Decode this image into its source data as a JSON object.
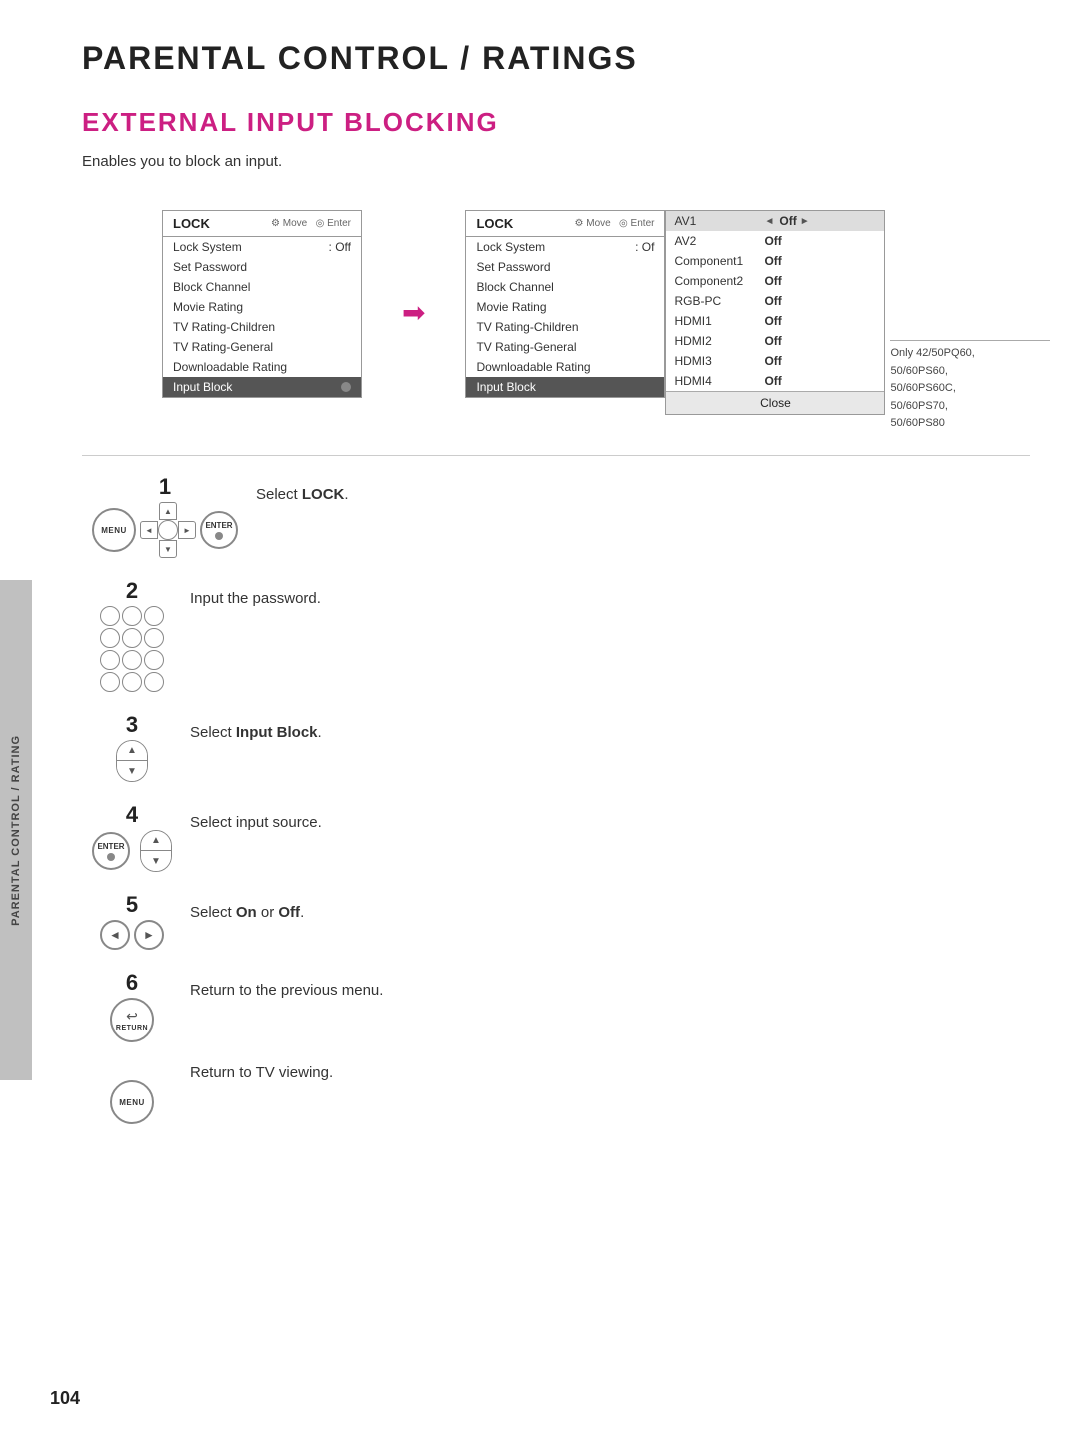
{
  "page": {
    "title": "PARENTAL CONTROL / RATINGS",
    "section_title": "EXTERNAL INPUT BLOCKING",
    "description": "Enables you to block an input.",
    "page_number": "104"
  },
  "sidebar": {
    "label": "PARENTAL CONTROL / RATING"
  },
  "left_menu": {
    "header_title": "LOCK",
    "header_nav": "Move   Enter",
    "items": [
      {
        "label": "Lock System",
        "value": ": Off",
        "highlighted": false
      },
      {
        "label": "Set Password",
        "value": "",
        "highlighted": false
      },
      {
        "label": "Block Channel",
        "value": "",
        "highlighted": false
      },
      {
        "label": "Movie Rating",
        "value": "",
        "highlighted": false
      },
      {
        "label": "TV Rating-Children",
        "value": "",
        "highlighted": false
      },
      {
        "label": "TV Rating-General",
        "value": "",
        "highlighted": false
      },
      {
        "label": "Downloadable Rating",
        "value": "",
        "highlighted": false
      },
      {
        "label": "Input Block",
        "value": "",
        "highlighted": true
      }
    ]
  },
  "right_menu": {
    "header_title": "LOCK",
    "header_nav": "Move   Enter",
    "items": [
      {
        "label": "Lock System",
        "value": ": Of",
        "highlighted": false
      },
      {
        "label": "Set Password",
        "value": "",
        "highlighted": false
      },
      {
        "label": "Block Channel",
        "value": "",
        "highlighted": false
      },
      {
        "label": "Movie Rating",
        "value": "",
        "highlighted": false
      },
      {
        "label": "TV Rating-Children",
        "value": "",
        "highlighted": false
      },
      {
        "label": "TV Rating-General",
        "value": "",
        "highlighted": false
      },
      {
        "label": "Downloadable Rating",
        "value": "",
        "highlighted": false
      },
      {
        "label": "Input Block",
        "value": "",
        "highlighted": true
      }
    ]
  },
  "submenu": {
    "inputs": [
      {
        "name": "AV1",
        "value": "Off",
        "has_arrows": true,
        "active": true
      },
      {
        "name": "AV2",
        "value": "Off",
        "has_arrows": false,
        "active": false
      },
      {
        "name": "Component1",
        "value": "Off",
        "has_arrows": false,
        "active": false
      },
      {
        "name": "Component2",
        "value": "Off",
        "has_arrows": false,
        "active": false
      },
      {
        "name": "RGB-PC",
        "value": "Off",
        "has_arrows": false,
        "active": false
      },
      {
        "name": "HDMI1",
        "value": "Off",
        "has_arrows": false,
        "active": false
      },
      {
        "name": "HDMI2",
        "value": "Off",
        "has_arrows": false,
        "active": false
      },
      {
        "name": "HDMI3",
        "value": "Off",
        "has_arrows": false,
        "active": false
      },
      {
        "name": "HDMI4",
        "value": "Off",
        "has_arrows": false,
        "active": false
      }
    ],
    "close_label": "Close",
    "side_note": "Only 42/50PQ60,\n50/60PS60,\n50/60PS60C,\n50/60PS70,\n50/60PS80"
  },
  "steps": [
    {
      "number": "1",
      "icon_type": "menu_enter",
      "text_parts": [
        "Select ",
        "LOCK",
        "."
      ]
    },
    {
      "number": "2",
      "icon_type": "numpad",
      "text_parts": [
        "Input the password."
      ]
    },
    {
      "number": "3",
      "icon_type": "updown",
      "text_parts": [
        "Select ",
        "Input Block",
        "."
      ]
    },
    {
      "number": "4",
      "icon_type": "enter_updown",
      "text_parts": [
        "Select input source."
      ]
    },
    {
      "number": "5",
      "icon_type": "lr",
      "text_parts": [
        "Select ",
        "On",
        " or ",
        "Off",
        "."
      ]
    },
    {
      "number": "6",
      "icon_type": "return_menu",
      "text_parts": [
        "Return to the previous menu.",
        "Return to TV viewing."
      ]
    }
  ]
}
